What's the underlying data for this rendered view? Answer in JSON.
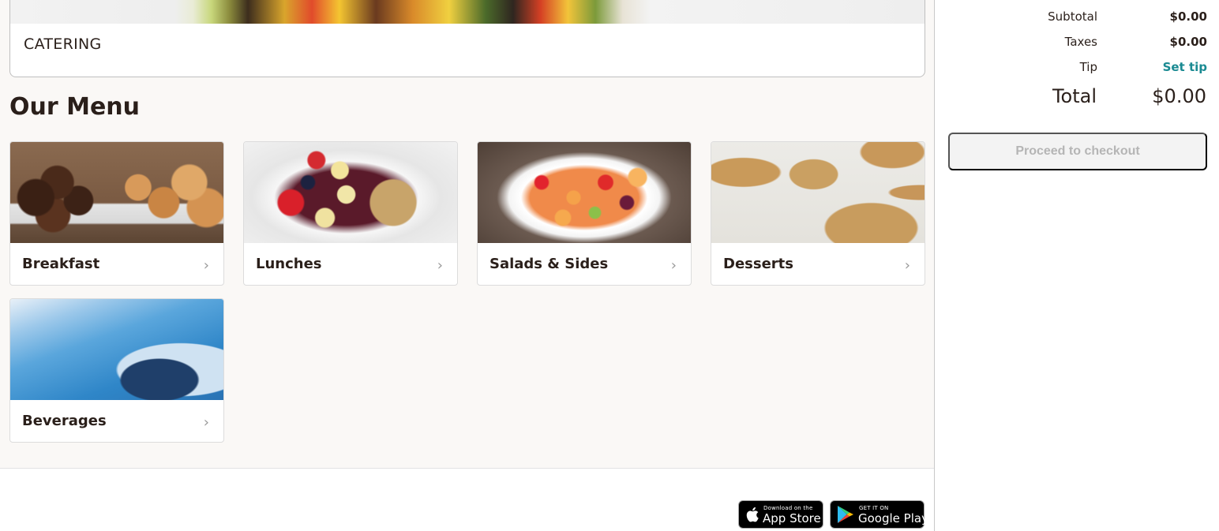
{
  "catering": {
    "title": "CATERING"
  },
  "menu": {
    "heading": "Our Menu",
    "categories": [
      {
        "label": "Breakfast",
        "image": "muffins-and-bagels-photo"
      },
      {
        "label": "Lunches",
        "image": "acai-bowl-photo"
      },
      {
        "label": "Salads & Sides",
        "image": "fruit-salad-photo"
      },
      {
        "label": "Desserts",
        "image": "cookies-photo"
      },
      {
        "label": "Beverages",
        "image": "water-pouring-photo"
      }
    ],
    "chevron": "›"
  },
  "order_summary": {
    "subtotal_label": "Subtotal",
    "subtotal_value": "$0.00",
    "taxes_label": "Taxes",
    "taxes_value": "$0.00",
    "tip_label": "Tip",
    "tip_action": "Set tip",
    "total_label": "Total",
    "total_value": "$0.00",
    "checkout_label": "Proceed to checkout"
  },
  "footer": {
    "app_store": {
      "small": "Download on the",
      "big": "App Store",
      "icon": "apple-icon"
    },
    "google_play": {
      "small": "GET IT ON",
      "big": "Google Play",
      "icon": "google-play-icon"
    }
  },
  "colors": {
    "accent_link": "#1a8a92",
    "text": "#2a1f1a",
    "page_bg": "#faf8f6",
    "disabled_button_bg": "#f3f3f3",
    "disabled_button_text": "#b5b5b5"
  }
}
